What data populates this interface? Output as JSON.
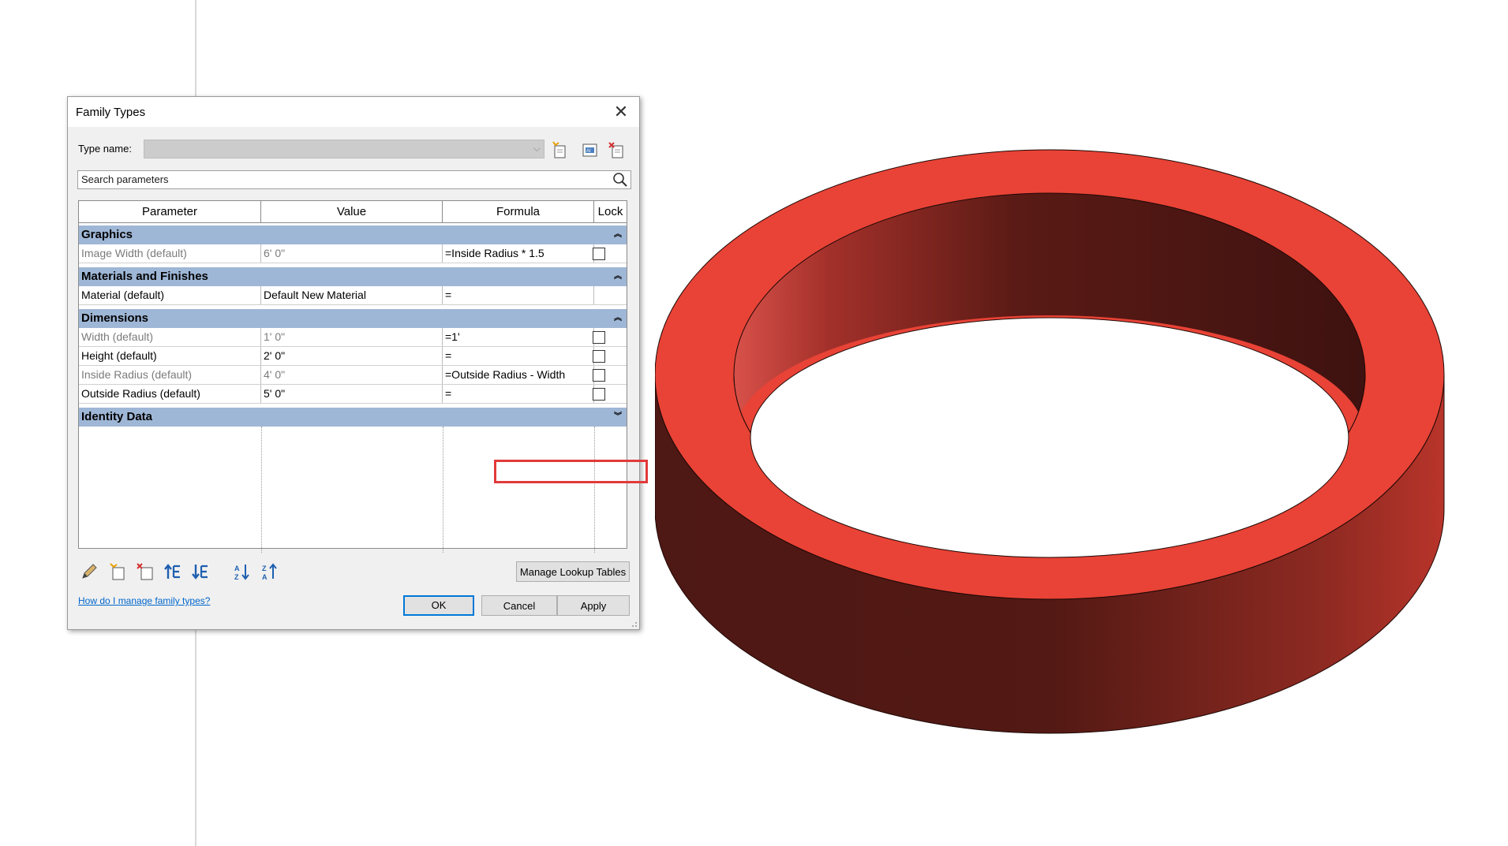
{
  "dialog": {
    "title": "Family Types",
    "type_name_label": "Type name:",
    "type_name_value": "",
    "search_placeholder": "Search parameters",
    "columns": [
      "Parameter",
      "Value",
      "Formula",
      "Lock"
    ],
    "groups": [
      {
        "name": "Graphics",
        "chevron": "up",
        "rows": [
          {
            "parameter": "Image Width (default)",
            "value": "6'  0\"",
            "formula": "=Inside Radius * 1.5",
            "lock": true,
            "dim": true
          }
        ]
      },
      {
        "name": "Materials and Finishes",
        "chevron": "up",
        "rows": [
          {
            "parameter": "Material (default)",
            "value": "Default New Material",
            "formula": "=",
            "lock": false,
            "dim": false
          }
        ]
      },
      {
        "name": "Dimensions",
        "chevron": "up",
        "rows": [
          {
            "parameter": "Width (default)",
            "value": "1'  0\"",
            "formula": "=1'",
            "lock": true,
            "dim": true
          },
          {
            "parameter": "Height (default)",
            "value": "2'  0\"",
            "formula": "=",
            "lock": true,
            "dim": false
          },
          {
            "parameter": "Inside Radius (default)",
            "value": "4'  0\"",
            "formula": "=Outside Radius - Width",
            "lock": true,
            "dim": true
          },
          {
            "parameter": "Outside Radius (default)",
            "value": "5'  0\"",
            "formula": "=",
            "lock": true,
            "dim": false
          }
        ]
      },
      {
        "name": "Identity Data",
        "chevron": "down",
        "rows": []
      }
    ],
    "buttons": {
      "manage_lookup": "Manage Lookup Tables",
      "ok": "OK",
      "cancel": "Cancel",
      "apply": "Apply"
    },
    "help_link": "How do I manage family types?",
    "toolbar_icons": [
      "new-type-icon",
      "rename-type-icon",
      "delete-type-icon"
    ],
    "bottom_icons": [
      "edit-parameter-icon",
      "new-parameter-icon",
      "delete-parameter-icon",
      "move-up-icon",
      "move-down-icon",
      "sort-ascending-icon",
      "sort-descending-icon"
    ]
  },
  "colors": {
    "group_header": "#9fb7d6",
    "highlight_box": "#e13a3a",
    "ring_top": "#e84336",
    "ring_side_dark": "#4e1814",
    "ring_side_light": "#b8342a"
  }
}
